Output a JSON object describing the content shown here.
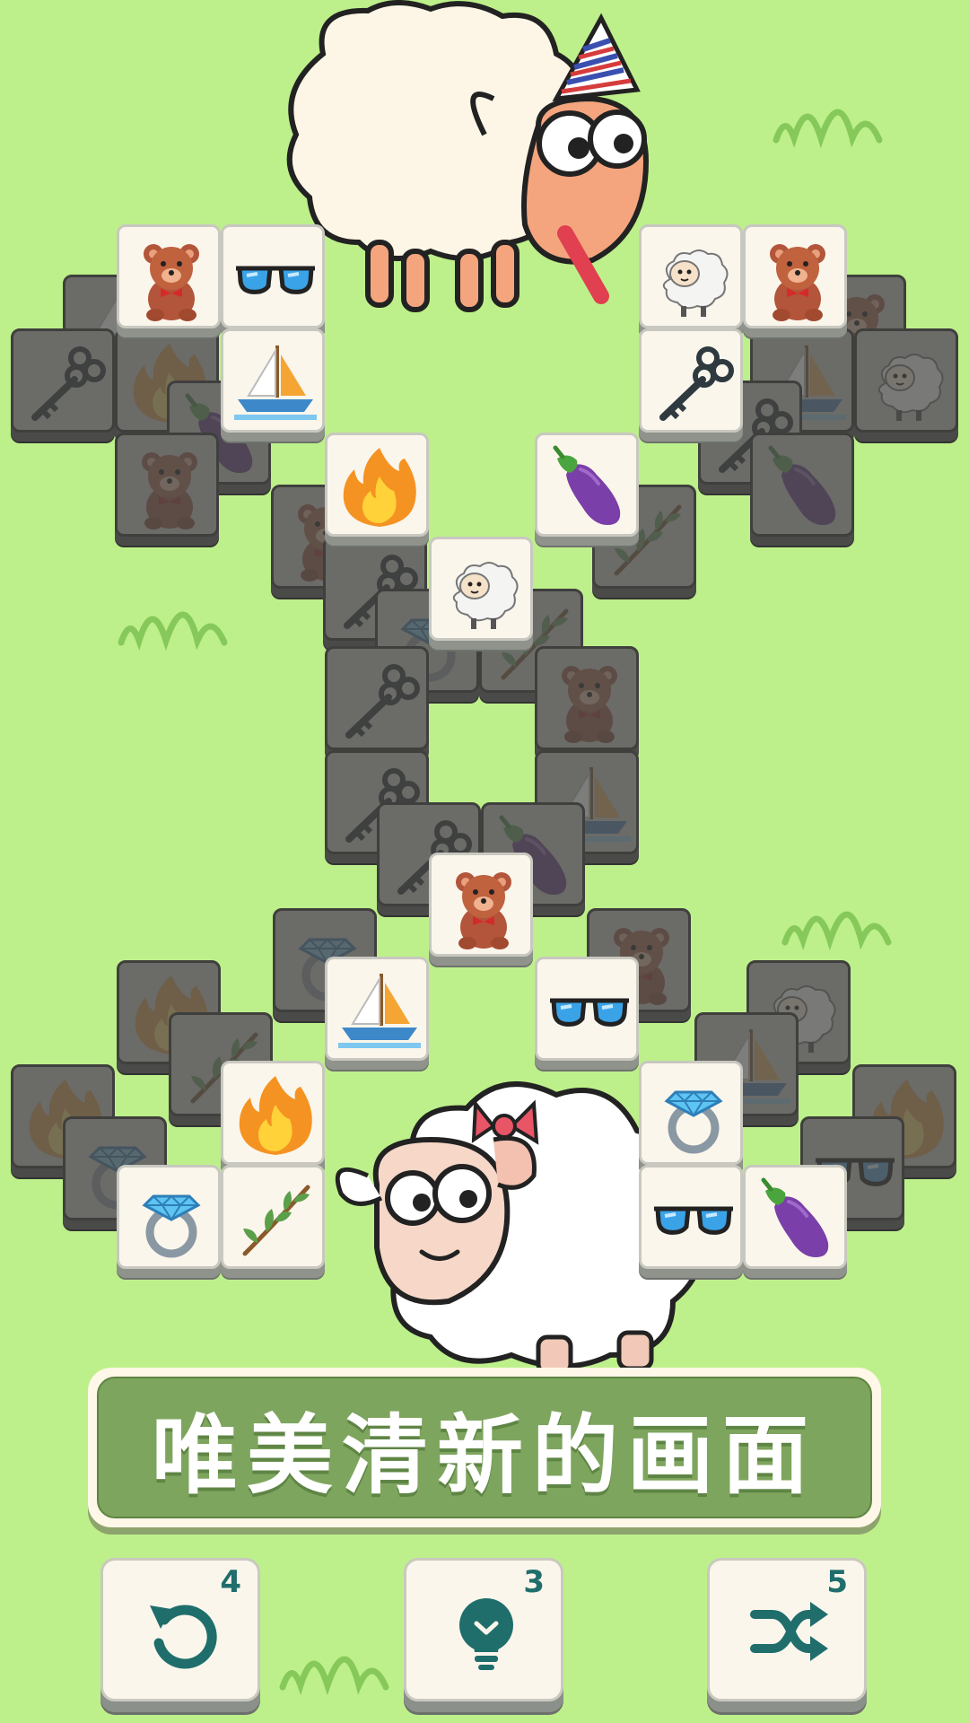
{
  "banner": {
    "text": "唯美清新的画面"
  },
  "controls": {
    "undo": {
      "count": "4",
      "icon": "undo-icon"
    },
    "hint": {
      "count": "3",
      "icon": "lightbulb-icon"
    },
    "shuffle": {
      "count": "5",
      "icon": "shuffle-icon"
    }
  },
  "colors": {
    "background": "#bdf08a",
    "banner": "#7ea55e",
    "icon_teal": "#1f6e6c",
    "tile_face": "#fbf6ec",
    "tile_locked": "#6b6b68"
  },
  "board": {
    "top_tiles": [
      "teddy-bear",
      "sunglasses",
      "sheep",
      "teddy-bear",
      "sailboat",
      "key",
      "fire",
      "eggplant",
      "sheep",
      "teddy-bear",
      "sailboat",
      "sunglasses",
      "fire",
      "ring",
      "sunglasses",
      "eggplant",
      "ring",
      "branch"
    ],
    "locked_tiles": [
      "sailboat",
      "key",
      "fire",
      "eggplant",
      "teddy-bear",
      "teddy-bear",
      "key",
      "ring",
      "branch",
      "teddy-bear",
      "sheep",
      "sailboat",
      "key",
      "ring",
      "eggplant",
      "key",
      "ring",
      "teddy-bear",
      "fire",
      "branch",
      "sheep",
      "fire",
      "ring",
      "sunglasses",
      "fire",
      "eggplant",
      "sunglasses",
      "branch"
    ]
  }
}
